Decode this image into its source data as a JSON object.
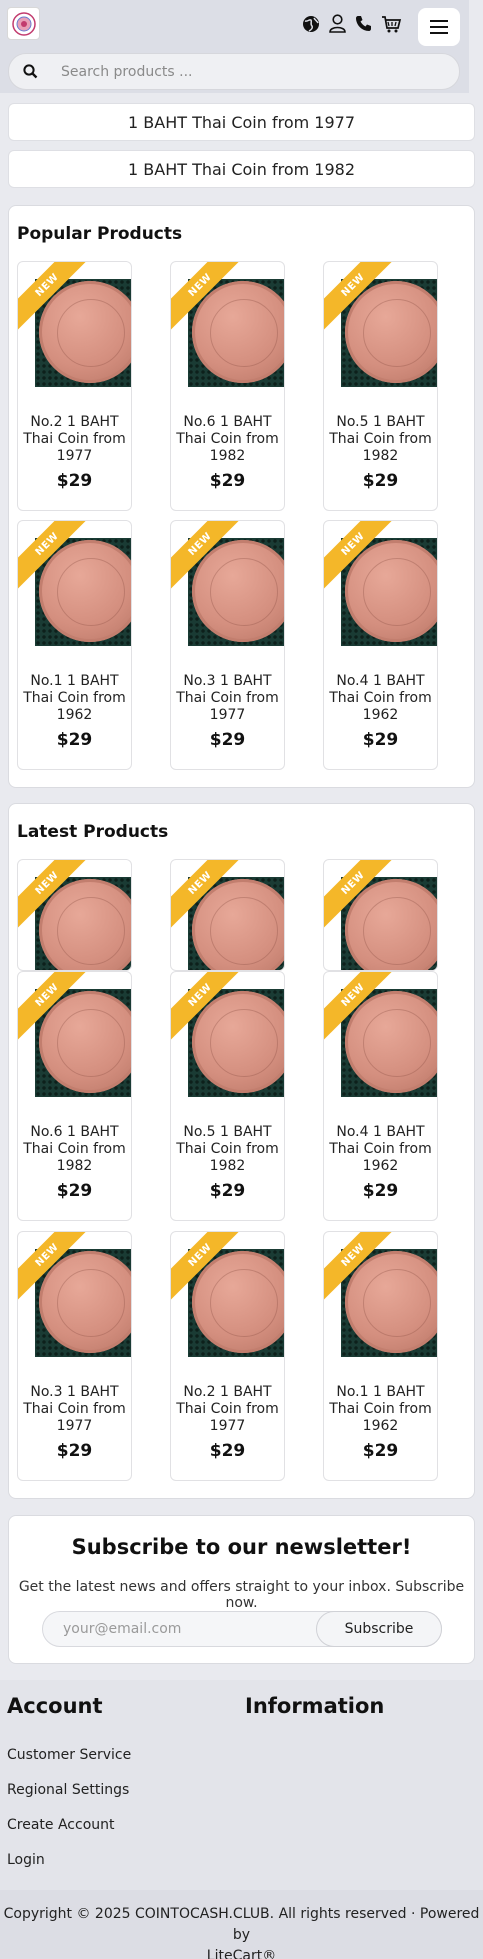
{
  "header": {
    "search_placeholder": "Search products ..."
  },
  "banners": [
    "1 BAHT Thai Coin from 1977",
    "1 BAHT Thai Coin from 1982"
  ],
  "popular": {
    "title": "Popular Products",
    "ribbon": "NEW",
    "products": [
      {
        "name": "No.2 1 BAHT Thai Coin from 1977",
        "price": "$29"
      },
      {
        "name": "No.6 1 BAHT Thai Coin from 1982",
        "price": "$29"
      },
      {
        "name": "No.5 1 BAHT Thai Coin from 1982",
        "price": "$29"
      },
      {
        "name": "No.1 1 BAHT Thai Coin from 1962",
        "price": "$29"
      },
      {
        "name": "No.3 1 BAHT Thai Coin from 1977",
        "price": "$29"
      },
      {
        "name": "No.4 1 BAHT Thai Coin from 1962",
        "price": "$29"
      }
    ]
  },
  "latest": {
    "title": "Latest Products",
    "ribbon": "NEW",
    "products": [
      {
        "name": "No.6 1 BAHT Thai Coin from 1982",
        "price": "$29"
      },
      {
        "name": "No.5 1 BAHT Thai Coin from 1982",
        "price": "$29"
      },
      {
        "name": "No.4 1 BAHT Thai Coin from 1962",
        "price": "$29"
      },
      {
        "name": "No.3 1 BAHT Thai Coin from 1977",
        "price": "$29"
      },
      {
        "name": "No.2 1 BAHT Thai Coin from 1977",
        "price": "$29"
      },
      {
        "name": "No.1 1 BAHT Thai Coin from 1962",
        "price": "$29"
      }
    ]
  },
  "newsletter": {
    "title": "Subscribe to our newsletter!",
    "text": "Get the latest news and offers straight to your inbox. Subscribe now.",
    "placeholder": "your@email.com",
    "button": "Subscribe"
  },
  "footer": {
    "account_title": "Account",
    "information_title": "Information",
    "links": [
      "Customer Service",
      "Regional Settings",
      "Create Account",
      "Login"
    ],
    "copyright": "Copyright © 2025 COINTOCASH.CLUB. All rights reserved · Powered by",
    "powered_link": "LiteCart®"
  },
  "icons": [
    "logo-icon",
    "globe-icon",
    "user-icon",
    "phone-icon",
    "cart-icon",
    "menu-icon",
    "search-icon"
  ]
}
